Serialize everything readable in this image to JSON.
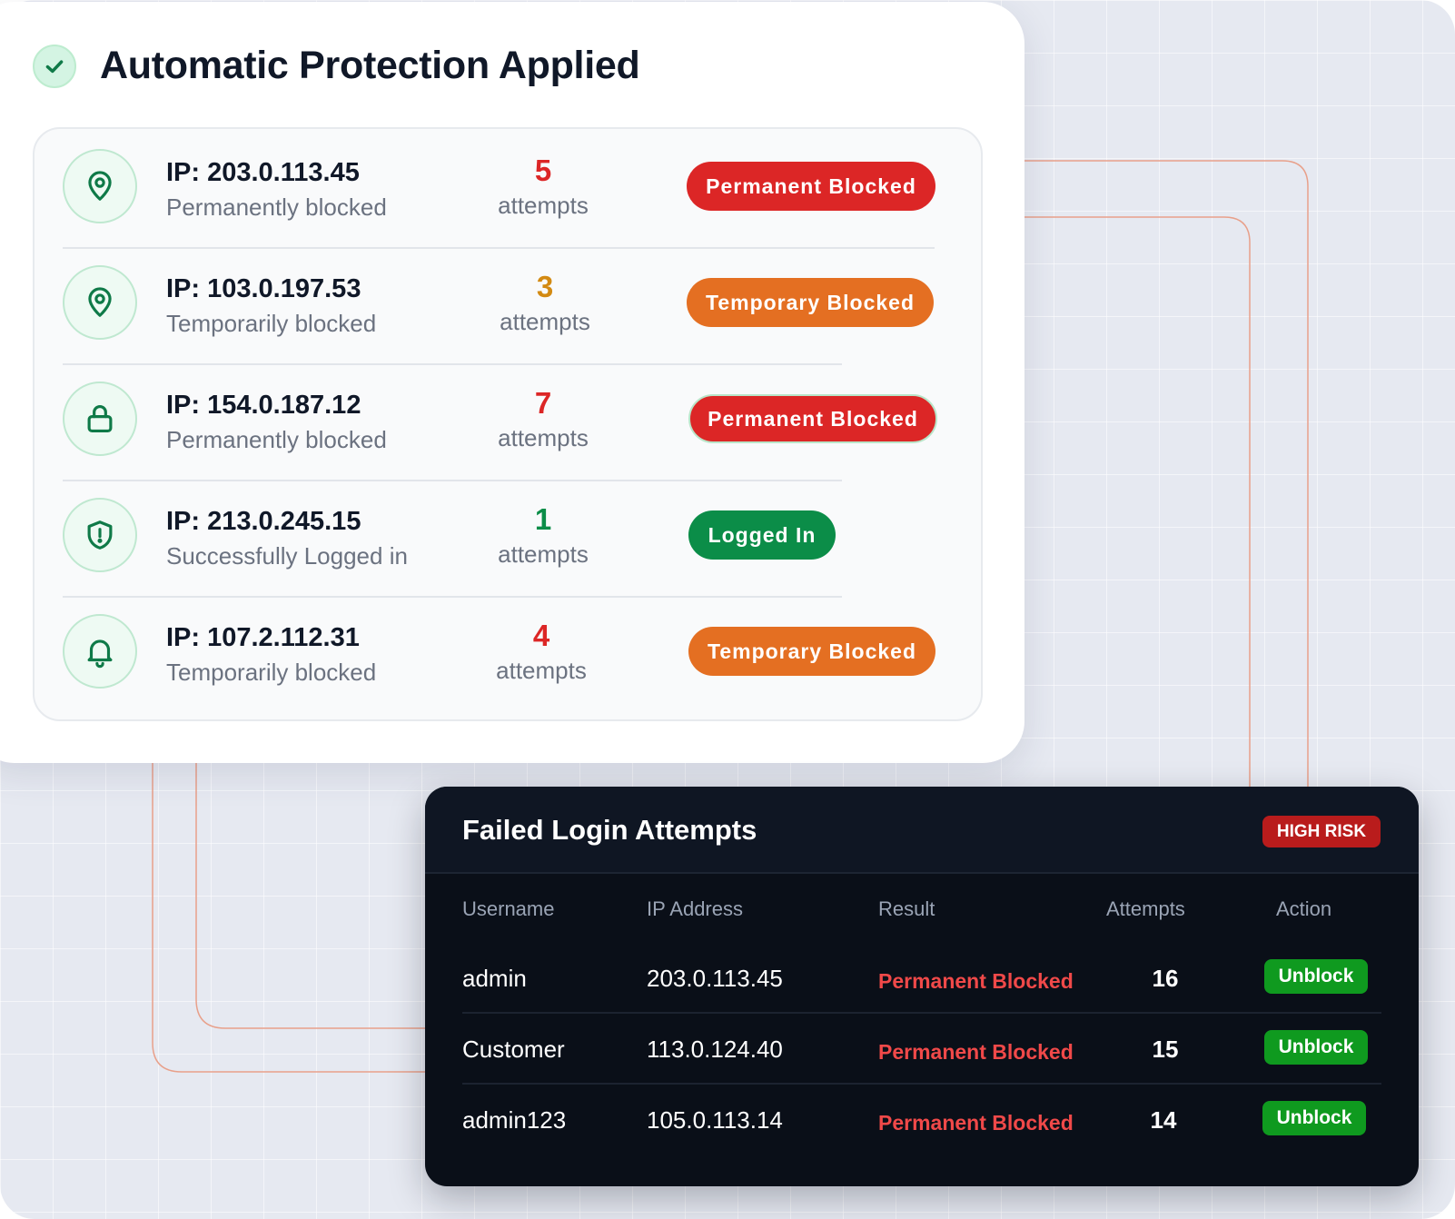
{
  "colors": {
    "red": "#dc2626",
    "orange": "#e46f22",
    "green": "#0b8d48",
    "accent_green": "#0f7a48",
    "dark_bg": "#0a0f18",
    "result_red": "#f04949",
    "unblock_green": "#0f9a1f"
  },
  "protection": {
    "title": "Automatic Protection Applied",
    "header_icon": "check-icon",
    "rows": [
      {
        "icon": "map-pin-icon",
        "ip": "IP: 203.0.113.45",
        "status": "Permanently blocked",
        "count": "5",
        "count_color": "#dc2626",
        "attempts_label": "attempts",
        "badge": "Permanent Blocked",
        "badge_color": "red"
      },
      {
        "icon": "map-pin-icon",
        "ip": "IP: 103.0.197.53",
        "status": "Temporarily blocked",
        "count": "3",
        "count_color": "#d38a12",
        "attempts_label": "attempts",
        "badge": "Temporary Blocked",
        "badge_color": "orange"
      },
      {
        "icon": "lock-icon",
        "ip": "IP: 154.0.187.12",
        "status": "Permanently blocked",
        "count": "7",
        "count_color": "#dc2626",
        "attempts_label": "attempts",
        "badge": "Permanent Blocked",
        "badge_color": "red"
      },
      {
        "icon": "shield-alert-icon",
        "ip": "IP: 213.0.245.15",
        "status": "Successfully Logged in",
        "count": "1",
        "count_color": "#0b8d48",
        "attempts_label": "attempts",
        "badge": "Logged In",
        "badge_color": "green"
      },
      {
        "icon": "bell-icon",
        "ip": "IP: 107.2.112.31",
        "status": "Temporarily blocked",
        "count": "4",
        "count_color": "#dc2626",
        "attempts_label": "attempts",
        "badge": "Temporary Blocked",
        "badge_color": "orange"
      }
    ]
  },
  "failed": {
    "title": "Failed Login Attempts",
    "risk_badge": "HIGH RISK",
    "columns": [
      "Username",
      "IP Address",
      "Result",
      "Attempts",
      "Action"
    ],
    "rows": [
      {
        "username": "admin",
        "ip": "203.0.113.45",
        "result": "Permanent Blocked",
        "attempts": "16",
        "action": "Unblock"
      },
      {
        "username": "Customer",
        "ip": "113.0.124.40",
        "result": "Permanent Blocked",
        "attempts": "15",
        "action": "Unblock"
      },
      {
        "username": "admin123",
        "ip": "105.0.113.14",
        "result": "Permanent Blocked",
        "attempts": "14",
        "action": "Unblock"
      }
    ]
  }
}
